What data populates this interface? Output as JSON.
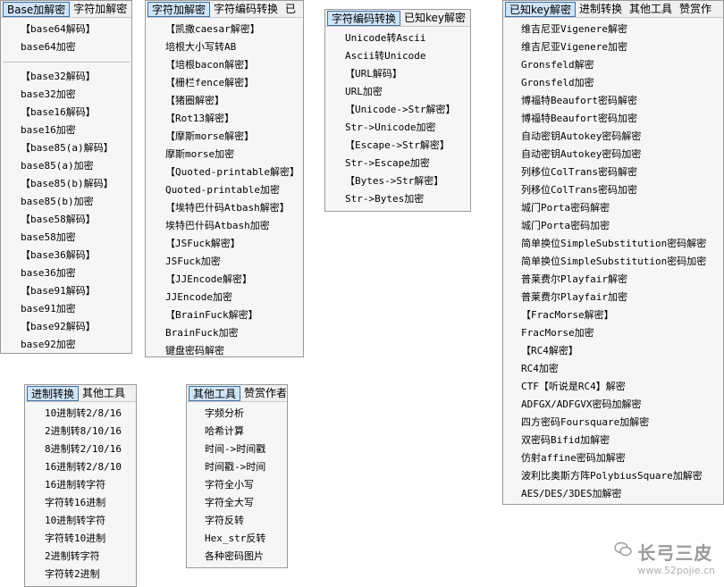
{
  "p1": {
    "tabs": [
      "Base加解密",
      "字符加解密"
    ],
    "items": [
      "【base64解码】",
      "base64加密",
      "---",
      "【base32解码】",
      "base32加密",
      "【base16解码】",
      "base16加密",
      "【base85(a)解码】",
      "base85(a)加密",
      "【base85(b)解码】",
      "base85(b)加密",
      "【base58解码】",
      "base58加密",
      "【base36解码】",
      "base36加密",
      "【base91解码】",
      "base91加密",
      "【base92解码】",
      "base92加密"
    ]
  },
  "p2": {
    "tabs": [
      "字符加解密",
      "字符编码转换",
      "已"
    ],
    "items": [
      "【凯撒caesar解密】",
      "培根大小写转AB",
      "【培根bacon解密】",
      "【栅栏fence解密】",
      "【猪圈解密】",
      "【Rot13解密】",
      "【摩斯morse解密】",
      "摩斯morse加密",
      "【Quoted-printable解密】",
      "Quoted-printable加密",
      "【埃特巴什码Atbash解密】",
      "埃特巴什码Atbash加密",
      "【JSFuck解密】",
      "JSFuck加密",
      "【JJEncode解密】",
      "JJEncode加密",
      "【BrainFuck解密】",
      "BrainFuck加密",
      "键盘密码解密"
    ]
  },
  "p3": {
    "tabs": [
      "字符编码转换",
      "已知key解密"
    ],
    "items": [
      "Unicode转Ascii",
      "Ascii转Unicode",
      "【URL解码】",
      "URL加密",
      "【Unicode->Str解密】",
      "Str->Unicode加密",
      "【Escape->Str解密】",
      "Str->Escape加密",
      "【Bytes->Str解密】",
      "Str->Bytes加密"
    ]
  },
  "p4": {
    "tabs": [
      "已知key解密",
      "进制转换",
      "其他工具",
      "赞赏作"
    ],
    "items": [
      "维吉尼亚Vigenere解密",
      "维吉尼亚Vigenere加密",
      "Gronsfeld解密",
      "Gronsfeld加密",
      "博福特Beaufort密码解密",
      "博福特Beaufort密码加密",
      "自动密钥Autokey密码解密",
      "自动密钥Autokey密码加密",
      "列移位ColTrans密码解密",
      "列移位ColTrans密码加密",
      "城门Porta密码解密",
      "城门Porta密码加密",
      "简单换位SimpleSubstitution密码解密",
      "简单换位SimpleSubstitution密码加密",
      "普莱费尔Playfair解密",
      "普莱费尔Playfair加密",
      "【FracMorse解密】",
      "FracMorse加密",
      "【RC4解密】",
      "RC4加密",
      "CTF【听说是RC4】解密",
      "ADFGX/ADFGVX密码加解密",
      "四方密码Foursquare加解密",
      "双密码Bifid加解密",
      "仿射affine密码加解密",
      "波利比奥斯方阵PolybiusSquare加解密",
      "AES/DES/3DES加解密"
    ]
  },
  "p5": {
    "tabs": [
      "进制转换",
      "其他工具"
    ],
    "items": [
      "10进制转2/8/16",
      "2进制转8/10/16",
      "8进制转2/10/16",
      "16进制转2/8/10",
      "16进制转字符",
      "字符转16进制",
      "10进制转字符",
      "字符转10进制",
      "2进制转字符",
      "字符转2进制"
    ]
  },
  "p6": {
    "tabs": [
      "其他工具",
      "赞赏作者"
    ],
    "items": [
      "字频分析",
      "哈希计算",
      "时间->时间戳",
      "时间戳->时间",
      "字符全小写",
      "字符全大写",
      "字符反转",
      "Hex_str反转",
      "各种密码图片"
    ]
  },
  "watermark": {
    "title": "长弓三皮",
    "url": "www.52pojie.cn"
  },
  "colors": {
    "active_tab_bg": "#cfe4f8",
    "active_tab_border": "#3d6fa5",
    "menu_bg": "#f6f6f6"
  }
}
